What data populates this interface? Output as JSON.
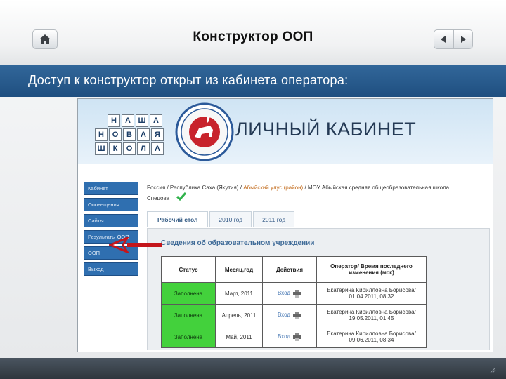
{
  "slide": {
    "title": "Конструктор ООП",
    "subtitle": "Доступ к конструктор открыт из кабинета оператора:",
    "nav": {
      "home_icon": "home-icon",
      "prev_icon": "arrow-left-icon",
      "next_icon": "arrow-right-icon"
    }
  },
  "screenshot": {
    "logo_rows": [
      [
        "Н",
        "А",
        "Ш",
        "А"
      ],
      [
        "Н",
        "О",
        "В",
        "А",
        "Я"
      ],
      [
        "Ш",
        "К",
        "О",
        "Л",
        "А"
      ]
    ],
    "cabinet_title": "ЛИЧНЫЙ КАБИНЕТ",
    "left_nav": [
      "Кабинет",
      "Оповещения",
      "Сайты",
      "Результаты ООП",
      "ООП",
      "Выход"
    ],
    "breadcrumb_prefix": "Россия / Республика Саха (Якутия) / ",
    "breadcrumb_link": "Абыйский улус (район)",
    "breadcrumb_suffix": " / МОУ Абыйская средняя общеобразовательная школа",
    "user_name": "Спецова",
    "tabs": [
      "Рабочий стол",
      "2010 год",
      "2011 год"
    ],
    "panel_title": "Сведения об образовательном учреждении",
    "table": {
      "headers": [
        "Статус",
        "Месяц,год",
        "Действия",
        "Оператор/ Время последнего изменения (мск)"
      ],
      "rows": [
        {
          "status": "Заполнена",
          "month": "Март, 2011",
          "action": "Вход",
          "operator": "Екатерина Кирилловна Борисова/ 01.04.2011, 08:32"
        },
        {
          "status": "Заполнена",
          "month": "Апрель, 2011",
          "action": "Вход",
          "operator": "Екатерина Кирилловна Борисова/ 19.05.2011, 01:45"
        },
        {
          "status": "Заполнена",
          "month": "Май, 2011",
          "action": "Вход",
          "operator": "Екатерина Кирилловна Борисова/ 09.06.2011, 08:34"
        }
      ]
    },
    "colors": {
      "status_green": "#43d13c",
      "arrow_red": "#c4161c",
      "nav_blue": "#2f6fb0"
    }
  }
}
